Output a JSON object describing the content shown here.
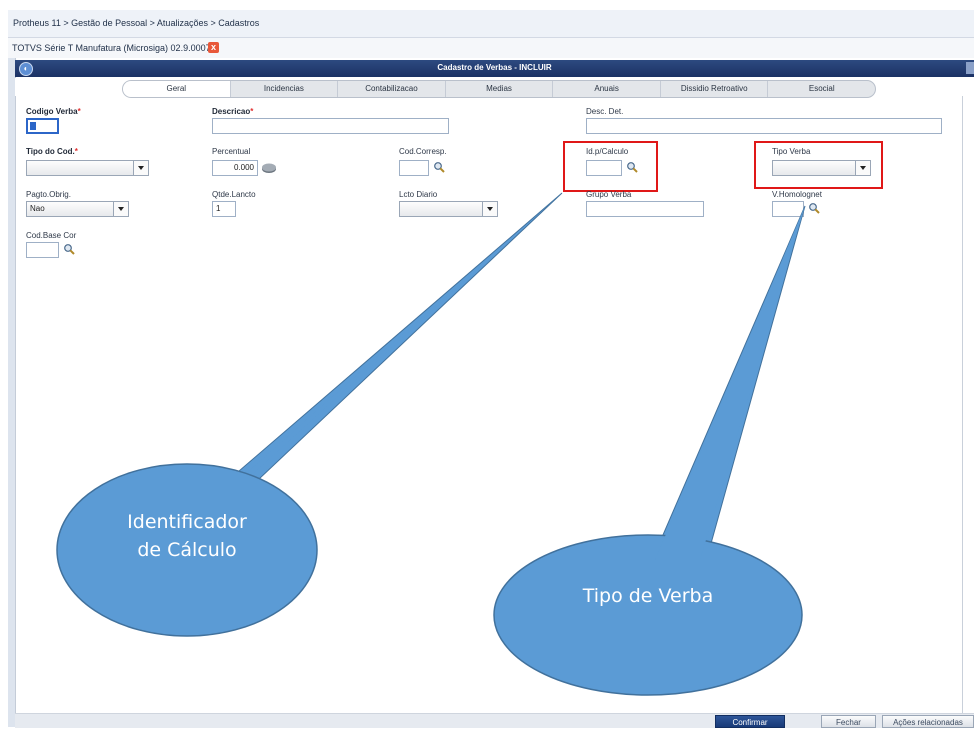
{
  "breadcrumb": "Protheus 11 > Gestão de Pessoal > Atualizações > Cadastros",
  "app_tab": {
    "label": "TOTVS Série T Manufatura (Microsiga) 02.9.0007",
    "close": "x"
  },
  "dialog": {
    "title": "Cadastro de Verbas - INCLUIR"
  },
  "tabs": [
    {
      "label": "Geral"
    },
    {
      "label": "Incidencias"
    },
    {
      "label": "Contabilizacao"
    },
    {
      "label": "Medias"
    },
    {
      "label": "Anuais"
    },
    {
      "label": "Dissidio Retroativo"
    },
    {
      "label": "Esocial"
    }
  ],
  "fields": {
    "codigo_verba": {
      "label": "Codigo Verba",
      "required": "*",
      "value": ""
    },
    "descricao": {
      "label": "Descricao",
      "required": "*",
      "value": ""
    },
    "desc_det": {
      "label": "Desc. Det.",
      "value": ""
    },
    "tipo_cod": {
      "label": "Tipo do Cod.",
      "required": "*",
      "value": ""
    },
    "percentual": {
      "label": "Percentual",
      "value": "0.000"
    },
    "cod_corresp": {
      "label": "Cod.Corresp.",
      "value": ""
    },
    "id_calculo": {
      "label": "Id.p/Calculo",
      "value": ""
    },
    "tipo_verba": {
      "label": "Tipo Verba",
      "value": ""
    },
    "pagto_obrig": {
      "label": "Pagto.Obrig.",
      "value": "Nao"
    },
    "qtde_lancto": {
      "label": "Qtde.Lancto",
      "value": "1"
    },
    "lcto_diario": {
      "label": "Lcto Diario",
      "value": ""
    },
    "grupo_verba": {
      "label": "Grupo Verba",
      "value": ""
    },
    "v_homolognet": {
      "label": "V.Homolognet",
      "value": ""
    },
    "cod_base_cor": {
      "label": "Cod.Base Cor",
      "value": ""
    }
  },
  "callouts": {
    "identificador": {
      "line1": "Identificador",
      "line2": "de Cálculo"
    },
    "tipo_verba": {
      "text": "Tipo de Verba"
    }
  },
  "buttons": {
    "confirmar": "Confirmar",
    "fechar": "Fechar",
    "acoes": "Ações relacionadas"
  },
  "colors": {
    "titlebar": "#1b3164",
    "callout": "#5b9bd5",
    "highlight": "#e01818",
    "confirm": "#183a78"
  }
}
